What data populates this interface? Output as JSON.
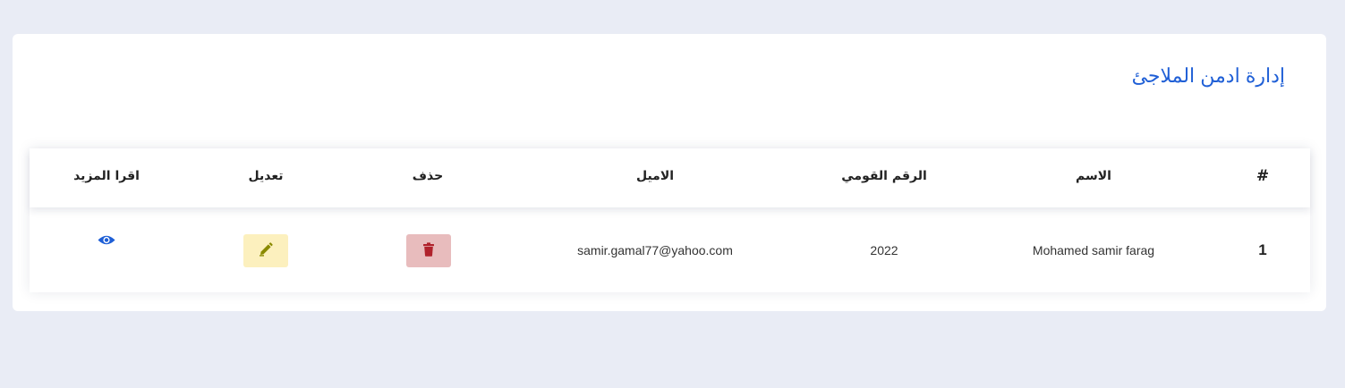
{
  "page": {
    "title": "إدارة ادمن الملاجئ"
  },
  "table": {
    "headers": {
      "index": "#",
      "name": "الاسم",
      "national_id": "الرقم القومي",
      "email": "الاميل",
      "delete": "حذف",
      "edit": "تعديل",
      "read_more": "اقرا المزيد"
    },
    "rows": [
      {
        "index": "1",
        "name": "Mohamed samir farag",
        "national_id": "2022",
        "email": "samir.gamal77@yahoo.com"
      }
    ]
  },
  "icons": {
    "delete": "trash-icon",
    "edit": "pencil-icon",
    "read_more": "eye-icon"
  },
  "colors": {
    "background": "#e9ecf5",
    "title": "#1f5fd6",
    "delete_bg": "#e8bcbd",
    "delete_icon": "#b0222c",
    "edit_bg": "#fcf0be",
    "edit_icon": "#8a8a00",
    "eye": "#1f5fd6"
  }
}
